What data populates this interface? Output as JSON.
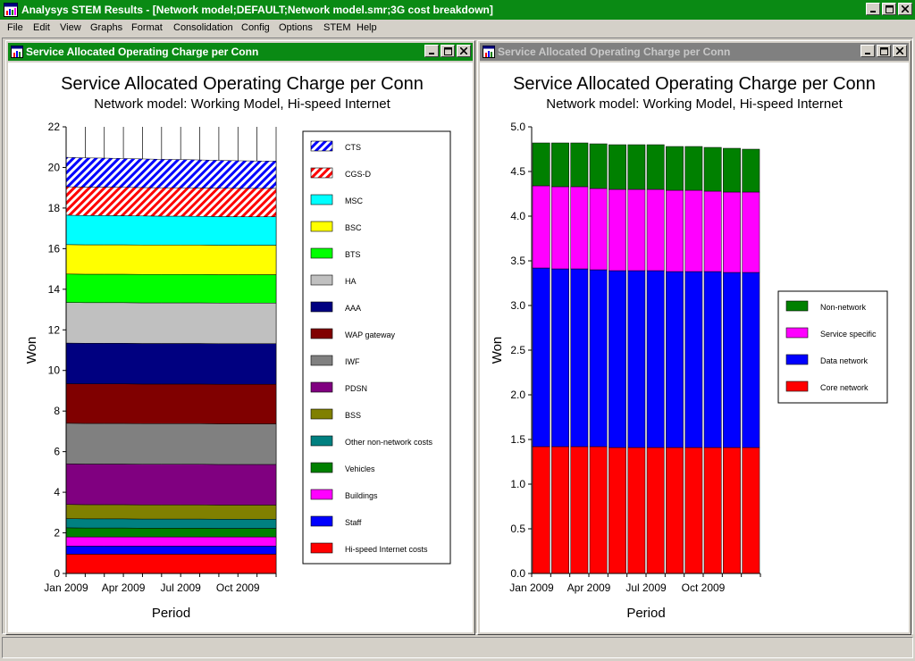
{
  "app": {
    "title": "Analysys STEM Results - [Network model;DEFAULT;Network model.smr;3G cost breakdown]",
    "icon": "chart-app-icon"
  },
  "menu": [
    "File",
    "Edit",
    "View",
    "Graphs",
    "Format",
    "Consolidation",
    "Config",
    "Options",
    "STEM",
    "Help"
  ],
  "status": "",
  "colors": {
    "active_title": "#0a8a14",
    "inactive_title": "#808080",
    "chrome": "#d4d0c8"
  },
  "windows": [
    {
      "title": "Service Allocated Operating Charge per Conn",
      "active": true
    },
    {
      "title": "Service Allocated Operating Charge per Conn",
      "active": false
    }
  ],
  "chart_data": [
    {
      "type": "area",
      "stacked": true,
      "title": "Service Allocated Operating Charge per Conn",
      "subtitle": "Network model:  Working Model, Hi-speed Internet",
      "xlabel": "Period",
      "ylabel": "Won",
      "ylim": [
        0,
        22
      ],
      "yticks": [
        "0",
        "2",
        "4",
        "6",
        "8",
        "10",
        "12",
        "14",
        "16",
        "18",
        "20",
        "22"
      ],
      "xticks": [
        "Jan 2009",
        "Apr 2009",
        "Jul 2009",
        "Oct 2009"
      ],
      "x": [
        "Jan 2009",
        "Feb 2009",
        "Mar 2009",
        "Apr 2009",
        "May 2009",
        "Jun 2009",
        "Jul 2009",
        "Aug 2009",
        "Sep 2009",
        "Oct 2009",
        "Nov 2009",
        "Dec 2009"
      ],
      "legend_position": "right",
      "series": [
        {
          "name": "Hi-speed Internet costs",
          "color": "#ff0000",
          "values": [
            0.95,
            0.95,
            0.95,
            0.95,
            0.95,
            0.95,
            0.95,
            0.95,
            0.95,
            0.95,
            0.95,
            0.95
          ]
        },
        {
          "name": "Staff",
          "color": "#0000ff",
          "values": [
            0.4,
            0.4,
            0.4,
            0.4,
            0.4,
            0.4,
            0.4,
            0.4,
            0.4,
            0.4,
            0.4,
            0.4
          ]
        },
        {
          "name": "Buildings",
          "color": "#ff00ff",
          "values": [
            0.45,
            0.45,
            0.45,
            0.45,
            0.45,
            0.45,
            0.45,
            0.45,
            0.45,
            0.45,
            0.45,
            0.45
          ]
        },
        {
          "name": "Vehicles",
          "color": "#008000",
          "values": [
            0.45,
            0.44,
            0.44,
            0.44,
            0.43,
            0.43,
            0.43,
            0.43,
            0.42,
            0.42,
            0.42,
            0.42
          ]
        },
        {
          "name": "Other non-network costs",
          "color": "#008080",
          "values": [
            0.45,
            0.45,
            0.45,
            0.45,
            0.45,
            0.45,
            0.45,
            0.45,
            0.45,
            0.45,
            0.45,
            0.45
          ]
        },
        {
          "name": "BSS",
          "color": "#808000",
          "values": [
            0.7,
            0.7,
            0.7,
            0.7,
            0.7,
            0.7,
            0.7,
            0.7,
            0.7,
            0.7,
            0.7,
            0.7
          ]
        },
        {
          "name": "PDSN",
          "color": "#800080",
          "values": [
            2.0,
            2.0,
            2.0,
            2.0,
            2.0,
            2.0,
            2.0,
            2.0,
            2.0,
            2.0,
            2.0,
            2.0
          ]
        },
        {
          "name": "IWF",
          "color": "#808080",
          "values": [
            2.0,
            2.0,
            2.0,
            2.0,
            2.0,
            2.0,
            2.0,
            2.0,
            2.0,
            2.0,
            2.0,
            2.0
          ]
        },
        {
          "name": "WAP gateway",
          "color": "#800000",
          "values": [
            1.95,
            1.95,
            1.95,
            1.95,
            1.95,
            1.95,
            1.95,
            1.95,
            1.95,
            1.95,
            1.95,
            1.95
          ]
        },
        {
          "name": "AAA",
          "color": "#000080",
          "values": [
            2.0,
            2.0,
            2.0,
            2.0,
            2.0,
            2.0,
            2.0,
            2.0,
            2.0,
            2.0,
            2.0,
            2.0
          ]
        },
        {
          "name": "HA",
          "color": "#c0c0c0",
          "values": [
            2.0,
            2.0,
            2.0,
            2.0,
            2.0,
            2.0,
            2.0,
            2.0,
            2.0,
            2.0,
            2.0,
            2.0
          ]
        },
        {
          "name": "BTS",
          "color": "#00ff00",
          "values": [
            1.4,
            1.4,
            1.4,
            1.4,
            1.4,
            1.4,
            1.4,
            1.4,
            1.4,
            1.4,
            1.4,
            1.4
          ]
        },
        {
          "name": "BSC",
          "color": "#ffff00",
          "values": [
            1.45,
            1.45,
            1.45,
            1.45,
            1.45,
            1.45,
            1.45,
            1.45,
            1.45,
            1.45,
            1.45,
            1.45
          ]
        },
        {
          "name": "MSC",
          "color": "#00ffff",
          "values": [
            1.45,
            1.44,
            1.44,
            1.43,
            1.43,
            1.42,
            1.42,
            1.41,
            1.41,
            1.4,
            1.4,
            1.4
          ]
        },
        {
          "name": "CGS-D",
          "color": "#ff0000",
          "pattern": "hatch",
          "values": [
            1.4,
            1.4,
            1.4,
            1.4,
            1.4,
            1.4,
            1.4,
            1.4,
            1.4,
            1.4,
            1.4,
            1.4
          ]
        },
        {
          "name": "CTS",
          "color": "#0000ff",
          "pattern": "hatch",
          "values": [
            1.45,
            1.44,
            1.43,
            1.42,
            1.41,
            1.4,
            1.39,
            1.38,
            1.37,
            1.36,
            1.35,
            1.34
          ]
        }
      ]
    },
    {
      "type": "bar",
      "stacked": true,
      "title": "Service Allocated Operating Charge per Conn",
      "subtitle": "Network model:  Working Model, Hi-speed Internet",
      "xlabel": "Period",
      "ylabel": "Won",
      "ylim": [
        0,
        5
      ],
      "yticks": [
        "0.0",
        "0.5",
        "1.0",
        "1.5",
        "2.0",
        "2.5",
        "3.0",
        "3.5",
        "4.0",
        "4.5",
        "5.0"
      ],
      "xticks": [
        "Jan 2009",
        "Apr 2009",
        "Jul 2009",
        "Oct 2009"
      ],
      "categories": [
        "Jan 2009",
        "Feb 2009",
        "Mar 2009",
        "Apr 2009",
        "May 2009",
        "Jun 2009",
        "Jul 2009",
        "Aug 2009",
        "Sep 2009",
        "Oct 2009",
        "Nov 2009",
        "Dec 2009"
      ],
      "legend_position": "right",
      "series": [
        {
          "name": "Core network",
          "color": "#ff0000",
          "values": [
            1.42,
            1.42,
            1.42,
            1.42,
            1.41,
            1.41,
            1.41,
            1.41,
            1.41,
            1.41,
            1.41,
            1.41
          ]
        },
        {
          "name": "Data network",
          "color": "#0000ff",
          "values": [
            2.0,
            1.99,
            1.99,
            1.98,
            1.98,
            1.98,
            1.98,
            1.97,
            1.97,
            1.97,
            1.96,
            1.96
          ]
        },
        {
          "name": "Service specific",
          "color": "#ff00ff",
          "values": [
            0.92,
            0.92,
            0.92,
            0.91,
            0.91,
            0.91,
            0.91,
            0.91,
            0.91,
            0.9,
            0.9,
            0.9
          ]
        },
        {
          "name": "Non-network",
          "color": "#008000",
          "values": [
            0.48,
            0.49,
            0.49,
            0.5,
            0.5,
            0.5,
            0.5,
            0.49,
            0.49,
            0.49,
            0.49,
            0.48
          ]
        }
      ]
    }
  ]
}
